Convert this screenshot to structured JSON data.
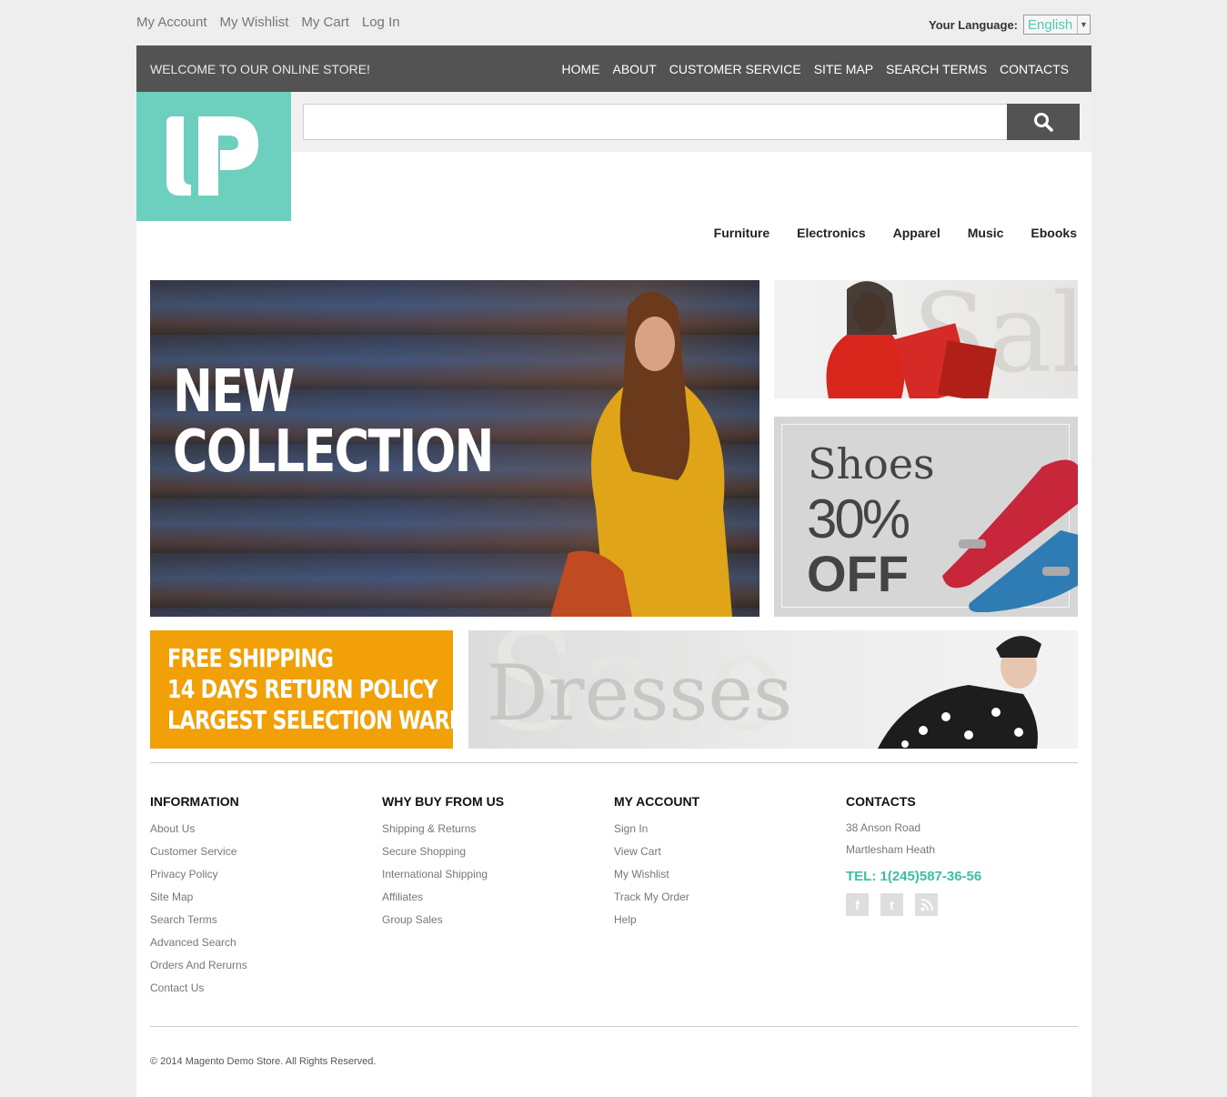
{
  "top_links": [
    "My Account",
    "My Wishlist",
    "My Cart",
    "Log In"
  ],
  "language": {
    "label": "Your Language:",
    "value": "English"
  },
  "header": {
    "welcome": "WELCOME TO OUR ONLINE STORE!",
    "nav": [
      "HOME",
      "ABOUT",
      "CUSTOMER SERVICE",
      "SITE MAP",
      "SEARCH TERMS",
      "CONTACTS"
    ]
  },
  "search": {
    "value": "",
    "placeholder": ""
  },
  "categories": [
    "Furniture",
    "Electronics",
    "Apparel",
    "Music",
    "Ebooks"
  ],
  "banners": {
    "main": {
      "line1": "NEW",
      "line2": "COLLECTION"
    },
    "sale": {
      "text": "Sal"
    },
    "shoes": {
      "line1": "Shoes",
      "line2": "30%",
      "line3": "OFF"
    },
    "shipping": {
      "line1": "FREE SHIPPING",
      "line2": "14 DAYS RETURN POLICY",
      "line3": "LARGEST SELECTION WARES"
    },
    "dresses": {
      "bg": "Sale",
      "fg": "Dresses"
    }
  },
  "footer": {
    "information": {
      "title": "INFORMATION",
      "links": [
        "About Us",
        "Customer Service",
        "Privacy Policy",
        "Site Map",
        "Search Terms",
        "Advanced Search",
        "Orders And Rerurns",
        "Contact Us"
      ]
    },
    "why_buy": {
      "title": "WHY BUY FROM US",
      "links": [
        "Shipping & Returns",
        "Secure Shopping",
        "International Shipping",
        "Affiliates",
        "Group Sales"
      ]
    },
    "my_account": {
      "title": "MY ACCOUNT",
      "links": [
        "Sign In",
        "View Cart",
        "My Wishlist",
        "Track My Order",
        "Help"
      ]
    },
    "contacts": {
      "title": "CONTACTS",
      "address1": "38 Anson Road",
      "address2": "Martlesham Heath",
      "tel": "TEL: 1(245)587-36-56",
      "socials": [
        "facebook-icon",
        "twitter-icon",
        "rss-icon"
      ]
    },
    "copyright": "© 2014 Magento Demo Store. All Rights Reserved."
  },
  "colors": {
    "accent": "#6dcfbd",
    "tel": "#3dbfa5",
    "header": "#535353",
    "shipping": "#f2a007"
  }
}
